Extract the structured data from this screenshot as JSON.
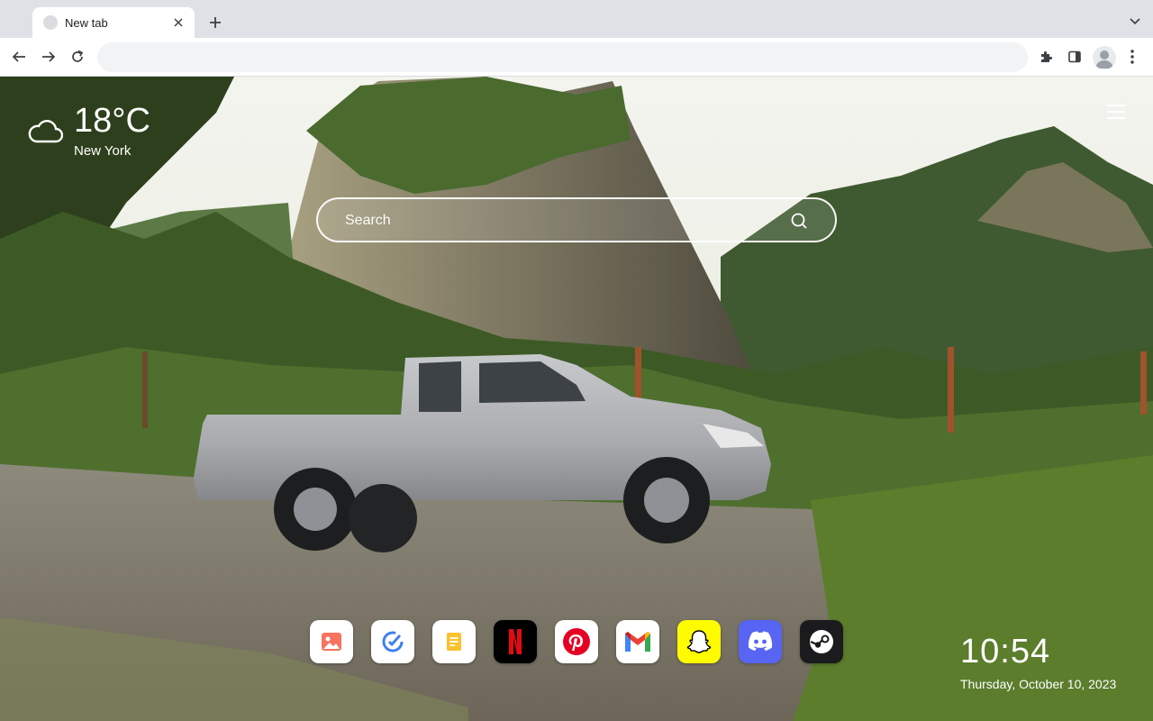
{
  "tab": {
    "title": "New tab"
  },
  "omnibox": {
    "value": ""
  },
  "weather": {
    "temperature": "18°C",
    "city": "New York",
    "icon": "cloud-icon"
  },
  "search": {
    "placeholder": "Search"
  },
  "apps": [
    {
      "name": "Photos",
      "icon": "image-icon",
      "bg": "#ffffff"
    },
    {
      "name": "Tasks",
      "icon": "check-icon",
      "bg": "#ffffff"
    },
    {
      "name": "Notes",
      "icon": "notes-icon",
      "bg": "#ffffff"
    },
    {
      "name": "Netflix",
      "icon": "netflix-icon",
      "bg": "#000000"
    },
    {
      "name": "Pinterest",
      "icon": "pinterest-icon",
      "bg": "#ffffff"
    },
    {
      "name": "Gmail",
      "icon": "gmail-icon",
      "bg": "#ffffff"
    },
    {
      "name": "Snapchat",
      "icon": "snapchat-icon",
      "bg": "#fffc00"
    },
    {
      "name": "Discord",
      "icon": "discord-icon",
      "bg": "#5865f2"
    },
    {
      "name": "Steam",
      "icon": "steam-icon",
      "bg": "#1b1b1d"
    }
  ],
  "clock": {
    "time": "10:54",
    "date": "Thursday, October 10, 2023"
  }
}
